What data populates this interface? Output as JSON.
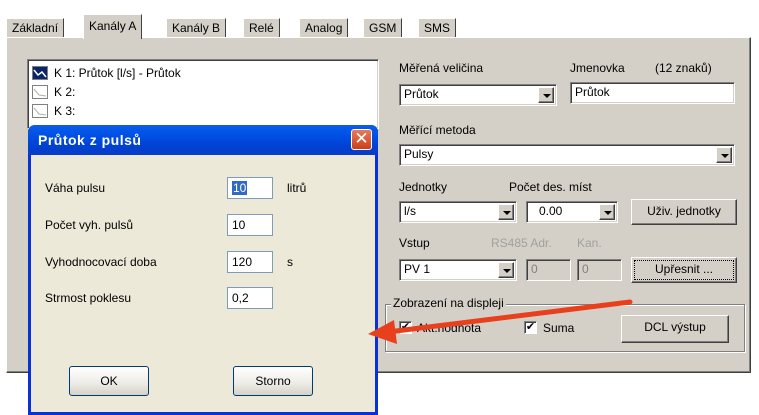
{
  "tabs": [
    {
      "label": "Základní"
    },
    {
      "label": "Kanály A"
    },
    {
      "label": "Kanály B"
    },
    {
      "label": "Relé"
    },
    {
      "label": "Analog"
    },
    {
      "label": "GSM"
    },
    {
      "label": "SMS"
    }
  ],
  "channels": [
    {
      "label": "K 1: Průtok [l/s] - Průtok"
    },
    {
      "label": "K 2:"
    },
    {
      "label": "K 3:"
    }
  ],
  "measured": {
    "label": "Měřená veličina",
    "value": "Průtok"
  },
  "name_field": {
    "label": "Jmenovka",
    "hint": "(12 znaků)",
    "value": "Průtok"
  },
  "method": {
    "label": "Měřící metoda",
    "value": "Pulsy"
  },
  "units": {
    "label": "Jednotky",
    "value": "l/s"
  },
  "decimals": {
    "label": "Počet des. míst",
    "value": "0.00"
  },
  "user_units_button": "Uživ. jednotky",
  "input": {
    "label": "Vstup",
    "value": "PV 1",
    "rs485_label": "RS485 Adr.",
    "rs485_value": "0",
    "kan_label": "Kan.",
    "kan_value": "0"
  },
  "specify_button": "Upřesnit ...",
  "display_group": {
    "title": "Zobrazení na displeji",
    "akt_label": "Akt.hodnota",
    "akt_checked": true,
    "suma_label": "Suma",
    "suma_checked": true,
    "dcl_button": "DCL výstup"
  },
  "dialog": {
    "title": "Průtok z pulsů",
    "close_glyph": "✕",
    "rows": [
      {
        "label": "Váha pulsu",
        "value": "10",
        "unit": "litrů"
      },
      {
        "label": "Počet vyh. pulsů",
        "value": "10",
        "unit": ""
      },
      {
        "label": "Vyhodnocovací doba",
        "value": "120",
        "unit": "s"
      },
      {
        "label": "Strmost poklesu",
        "value": "0,2",
        "unit": ""
      }
    ],
    "ok_label": "OK",
    "cancel_label": "Storno"
  },
  "colors": {
    "panel": "#d4d0c8",
    "dialog_title": "#0050e6",
    "arrow": "#e8401c"
  }
}
